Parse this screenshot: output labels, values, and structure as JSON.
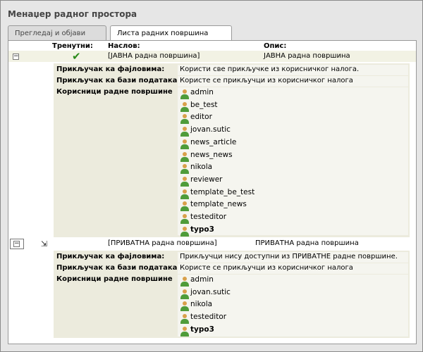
{
  "page_title": "Менаџер радног простора",
  "tabs": [
    {
      "label": "Прегледај и објави"
    },
    {
      "label": "Листа радних површина"
    }
  ],
  "columns": {
    "current": "Тренутни:",
    "title": "Наслов:",
    "description": "Опис:"
  },
  "workspaces": [
    {
      "title": "[ЈАВНА радна површина]",
      "description": "ЈАВНА радна површина",
      "status_icon": "checkmark-icon",
      "file_mounts_label": "Прикључак ка фајловима:",
      "file_mounts_value": "Користи све прикључке из корисничког налога.",
      "db_mounts_label": "Прикључак ка бази података:",
      "db_mounts_value": "Користе се прикључци из корисничког налога",
      "users_label": "Корисници радне површине",
      "users": [
        {
          "name": "admin"
        },
        {
          "name": "be_test"
        },
        {
          "name": "editor"
        },
        {
          "name": "jovan.sutic"
        },
        {
          "name": "news_article"
        },
        {
          "name": "news_news"
        },
        {
          "name": "nikola"
        },
        {
          "name": "reviewer"
        },
        {
          "name": "template_be_test"
        },
        {
          "name": "template_news"
        },
        {
          "name": "testeditor"
        },
        {
          "name": "typo3"
        }
      ]
    },
    {
      "title": "[ПРИВАТНА радна површина]",
      "description": "ПРИВАТНА радна површина",
      "status_icon": "switch-workspace-icon",
      "file_mounts_label": "Прикључак ка фајловима:",
      "file_mounts_value": "Прикључци нису доступни из ПРИВАТНЕ радне површине.",
      "db_mounts_label": "Прикључак ка бази података:",
      "db_mounts_value": "Користе се прикључци из корисничког налога",
      "users_label": "Корисници радне површине",
      "users": [
        {
          "name": "admin"
        },
        {
          "name": "jovan.sutic"
        },
        {
          "name": "nikola"
        },
        {
          "name": "testeditor"
        },
        {
          "name": "typo3"
        }
      ]
    }
  ],
  "colors": {
    "row_bg": "#f2f2e4",
    "detail_bg": "#ecebdd",
    "check_green": "#2a8a1a"
  }
}
